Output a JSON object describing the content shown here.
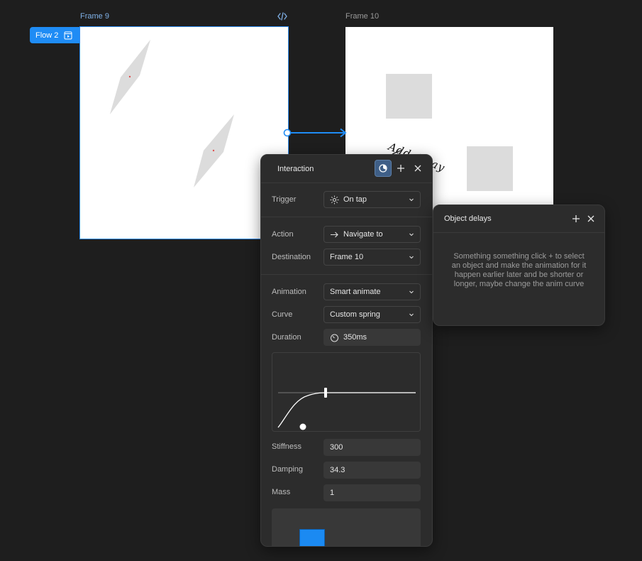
{
  "canvas": {
    "frames": [
      {
        "name": "Frame 9"
      },
      {
        "name": "Frame 10"
      }
    ],
    "flow_label": "Flow 2",
    "annotation": "Add delay",
    "icons": {
      "code": "code-icon",
      "flow": "play-frame-icon"
    }
  },
  "interaction_panel": {
    "title": "Interaction",
    "trigger": {
      "label": "Trigger",
      "value": "On tap"
    },
    "action": {
      "label": "Action",
      "value": "Navigate to"
    },
    "destination": {
      "label": "Destination",
      "value": "Frame 10"
    },
    "animation": {
      "label": "Animation",
      "value": "Smart animate"
    },
    "curve": {
      "label": "Curve",
      "value": "Custom spring"
    },
    "duration": {
      "label": "Duration",
      "value": "350ms"
    },
    "stiffness": {
      "label": "Stiffness",
      "value": "300"
    },
    "damping": {
      "label": "Damping",
      "value": "34.3"
    },
    "mass": {
      "label": "Mass",
      "value": "1"
    }
  },
  "delays_panel": {
    "title": "Object delays",
    "message": "Something something click + to select an object and make the animation for it happen earlier later and be shorter or longer, maybe change the anim curve"
  },
  "colors": {
    "canvas_bg": "#1e1e1e",
    "accent": "#1f8cf5",
    "panel_bg": "#2c2c2c"
  }
}
